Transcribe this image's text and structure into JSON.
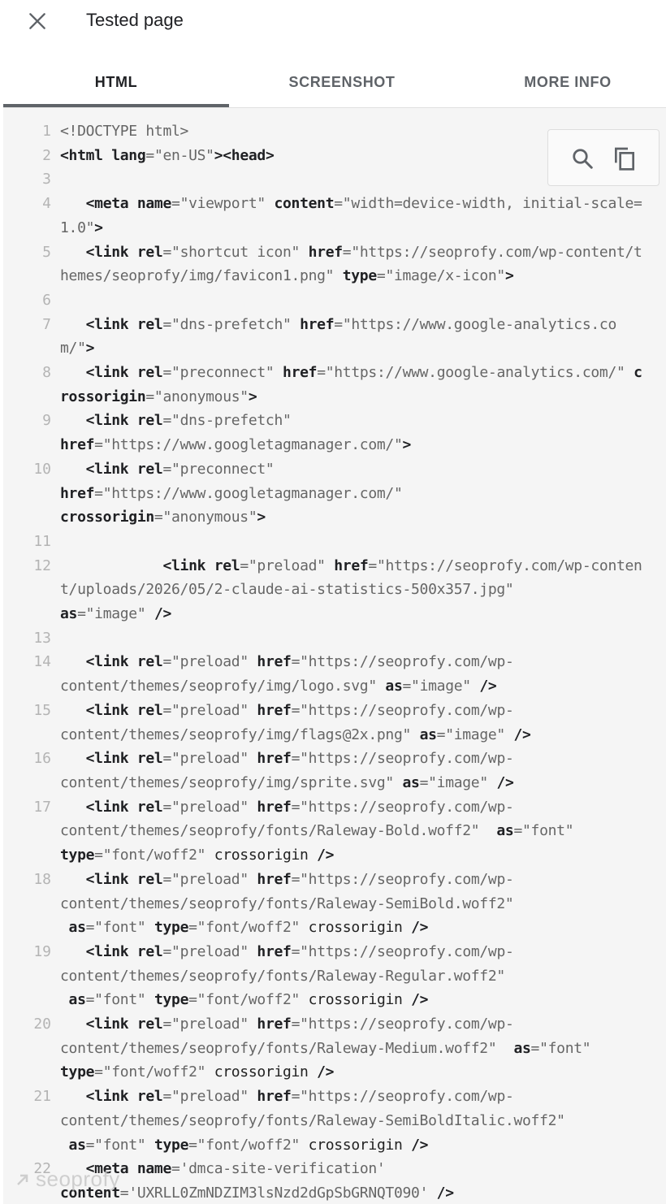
{
  "header": {
    "title": "Tested page",
    "close_icon": "close-icon"
  },
  "tabs": [
    {
      "label": "HTML",
      "active": true
    },
    {
      "label": "SCREENSHOT",
      "active": false
    },
    {
      "label": "MORE INFO",
      "active": false
    }
  ],
  "toolbar": {
    "search_icon": "search-icon",
    "copy_icon": "copy-icon"
  },
  "code_lines": [
    {
      "n": "1",
      "t": "<!DOCTYPE html>"
    },
    {
      "n": "2",
      "t": "<html lang=\"en-US\"><head>"
    },
    {
      "n": "3",
      "t": ""
    },
    {
      "n": "4",
      "t": "   <meta name=\"viewport\" content=\"width=device-width, initial-scale=1.0\">"
    },
    {
      "n": "5",
      "t": "   <link rel=\"shortcut icon\" href=\"https://seoprofy.com/wp-content/themes/seoprofy/img/favicon1.png\" type=\"image/x-icon\">"
    },
    {
      "n": "6",
      "t": ""
    },
    {
      "n": "7",
      "t": "   <link rel=\"dns-prefetch\" href=\"https://www.google-analytics.com/\">"
    },
    {
      "n": "8",
      "t": "   <link rel=\"preconnect\" href=\"https://www.google-analytics.com/\" crossorigin=\"anonymous\">"
    },
    {
      "n": "9",
      "t": "   <link rel=\"dns-prefetch\"\nhref=\"https://www.googletagmanager.com/\">"
    },
    {
      "n": "10",
      "t": "   <link rel=\"preconnect\"\nhref=\"https://www.googletagmanager.com/\"\ncrossorigin=\"anonymous\">"
    },
    {
      "n": "11",
      "t": ""
    },
    {
      "n": "12",
      "t": "            <link rel=\"preload\" href=\"https://seoprofy.com/wp-content/uploads/2026/05/2-claude-ai-statistics-500x357.jpg\"\nas=\"image\" />"
    },
    {
      "n": "13",
      "t": ""
    },
    {
      "n": "14",
      "t": "   <link rel=\"preload\" href=\"https://seoprofy.com/wp-\ncontent/themes/seoprofy/img/logo.svg\" as=\"image\" />"
    },
    {
      "n": "15",
      "t": "   <link rel=\"preload\" href=\"https://seoprofy.com/wp-\ncontent/themes/seoprofy/img/flags@2x.png\" as=\"image\" />"
    },
    {
      "n": "16",
      "t": "   <link rel=\"preload\" href=\"https://seoprofy.com/wp-\ncontent/themes/seoprofy/img/sprite.svg\" as=\"image\" />"
    },
    {
      "n": "17",
      "t": "   <link rel=\"preload\" href=\"https://seoprofy.com/wp-\ncontent/themes/seoprofy/fonts/Raleway-Bold.woff2\"  as=\"font\"\ntype=\"font/woff2\" crossorigin />"
    },
    {
      "n": "18",
      "t": "   <link rel=\"preload\" href=\"https://seoprofy.com/wp-\ncontent/themes/seoprofy/fonts/Raleway-SemiBold.woff2\"\n as=\"font\" type=\"font/woff2\" crossorigin />"
    },
    {
      "n": "19",
      "t": "   <link rel=\"preload\" href=\"https://seoprofy.com/wp-\ncontent/themes/seoprofy/fonts/Raleway-Regular.woff2\"\n as=\"font\" type=\"font/woff2\" crossorigin />"
    },
    {
      "n": "20",
      "t": "   <link rel=\"preload\" href=\"https://seoprofy.com/wp-\ncontent/themes/seoprofy/fonts/Raleway-Medium.woff2\"  as=\"font\"\ntype=\"font/woff2\" crossorigin />"
    },
    {
      "n": "21",
      "t": "   <link rel=\"preload\" href=\"https://seoprofy.com/wp-\ncontent/themes/seoprofy/fonts/Raleway-SemiBoldItalic.woff2\"\n as=\"font\" type=\"font/woff2\" crossorigin />"
    },
    {
      "n": "22",
      "t": "   <meta name='dmca-site-verification'\ncontent='UXRLL0ZmNDZIM3lsNzd2dGpSbGRNQT090' />"
    }
  ],
  "watermark": "seoprofy",
  "colors": {
    "panel_bg": "#f5f5f5",
    "line_number": "#b4b4b4",
    "attr_value": "#666666",
    "tab_indicator": "#5f6368"
  }
}
